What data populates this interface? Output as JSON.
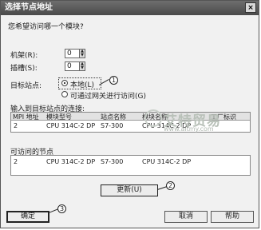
{
  "window": {
    "title": "选择节点地址",
    "close_symbol": "×"
  },
  "question": "您希望访问哪一个模块?",
  "rack": {
    "label": "机架(R):",
    "value": "0"
  },
  "slot": {
    "label": "插槽(S):",
    "value": "0"
  },
  "target_station": {
    "label": "目标站点:",
    "options": [
      {
        "label": "本地(L)",
        "selected": true
      },
      {
        "label": "可通过网关进行访问(G)",
        "selected": false
      }
    ]
  },
  "connected": {
    "title": "输入到目标站点的连接:",
    "columns": [
      "MPI 地址",
      "模块型号",
      "站点名称",
      "模块名称",
      "工厂标识"
    ],
    "rows": [
      [
        "2",
        "CPU 314C-2 DP",
        "S7-300",
        "CPU 314C-2 DP",
        ""
      ]
    ]
  },
  "accessible": {
    "title": "可访问的节点",
    "rows": [
      [
        "2",
        "CPU 314C-2 DP",
        "S7-300",
        "CPU 314C-2 DP"
      ]
    ]
  },
  "buttons": {
    "refresh": "更新(U)",
    "ok": "确定",
    "cancel": "取消",
    "help": "帮助"
  },
  "callouts": [
    "1",
    "2",
    "3"
  ],
  "watermark": {
    "text": "艾特贸易",
    "url": "www.aitmy.com"
  }
}
